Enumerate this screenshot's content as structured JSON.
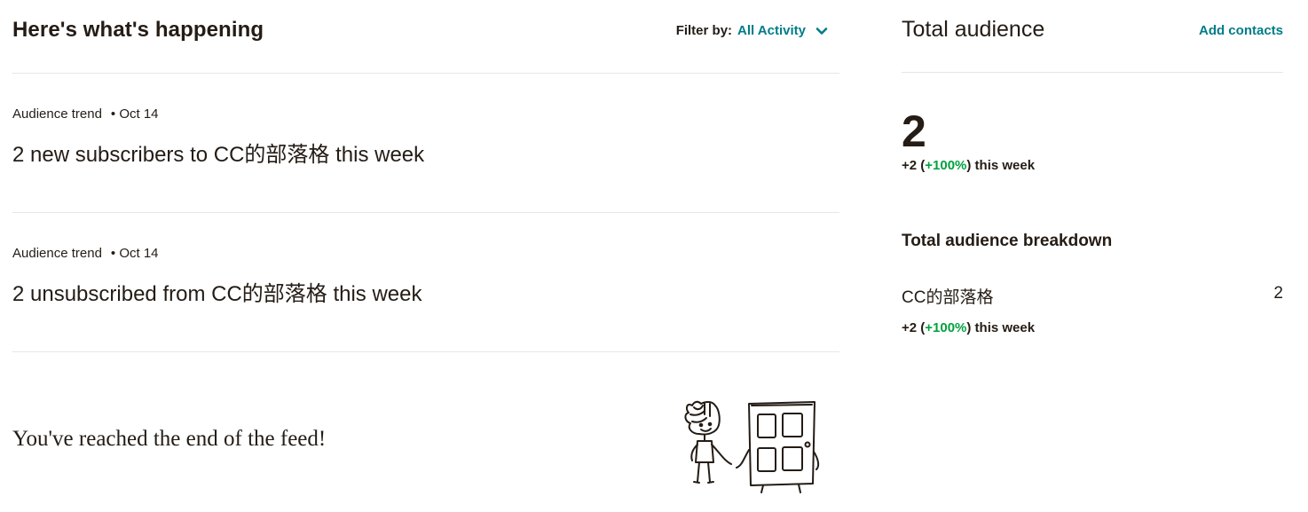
{
  "feed": {
    "title": "Here's what's happening",
    "filter": {
      "label": "Filter by:",
      "value": "All Activity"
    },
    "items": [
      {
        "type": "Audience trend",
        "date": "• Oct 14",
        "text": "2 new subscribers to CC的部落格 this week"
      },
      {
        "type": "Audience trend",
        "date": "• Oct 14",
        "text": "2 unsubscribed from CC的部落格 this week"
      }
    ],
    "end_message": "You've reached the end of the feed!"
  },
  "audience": {
    "title": "Total audience",
    "add_contacts": "Add contacts",
    "total": "2",
    "change": {
      "prefix": "+2 (",
      "percent": "+100%",
      "suffix": ") this week"
    },
    "breakdown_title": "Total audience breakdown",
    "breakdown": [
      {
        "name": "CC的部落格",
        "value": "2",
        "change_prefix": "+2 (",
        "change_percent": "+100%",
        "change_suffix": ") this week"
      }
    ]
  },
  "colors": {
    "accent": "#007c89",
    "positive": "#00a23e",
    "text": "#241c15",
    "divider": "#e6e6e6"
  },
  "icons": {
    "filter_chevron": "chevron-down-icon",
    "end_illustration": "person-and-door-illustration"
  }
}
